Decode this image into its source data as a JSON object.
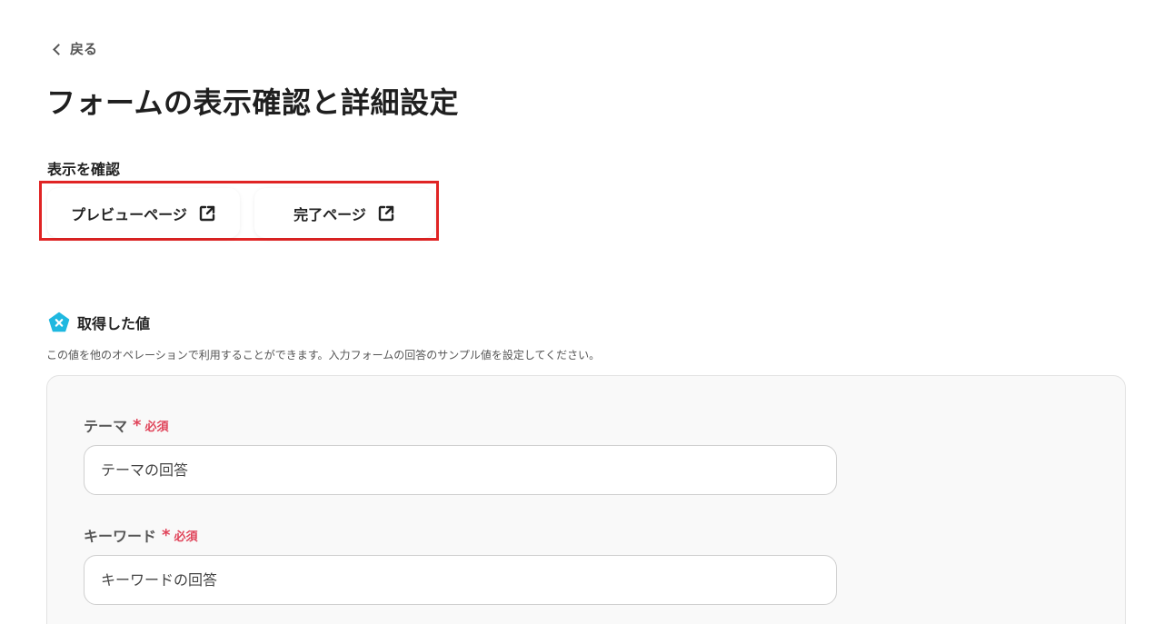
{
  "nav": {
    "back_label": "戻る"
  },
  "page": {
    "title": "フォームの表示確認と詳細設定"
  },
  "display_check": {
    "label": "表示を確認",
    "buttons": [
      {
        "label": "プレビューページ",
        "icon": "external-link-icon"
      },
      {
        "label": "完了ページ",
        "icon": "external-link-icon"
      }
    ]
  },
  "acquired_values": {
    "title": "取得した値",
    "icon": "x-pentagon-icon",
    "description": "この値を他のオペレーションで利用することができます。入力フォームの回答のサンプル値を設定してください。",
    "fields": [
      {
        "label": "テーマ",
        "required_mark": "*",
        "required_text": "必須",
        "placeholder": "テーマの回答"
      },
      {
        "label": "キーワード",
        "required_mark": "*",
        "required_text": "必須",
        "placeholder": "キーワードの回答"
      }
    ]
  },
  "colors": {
    "highlight": "#e02424",
    "required": "#e0445a",
    "badge": "#1fb8e0"
  }
}
